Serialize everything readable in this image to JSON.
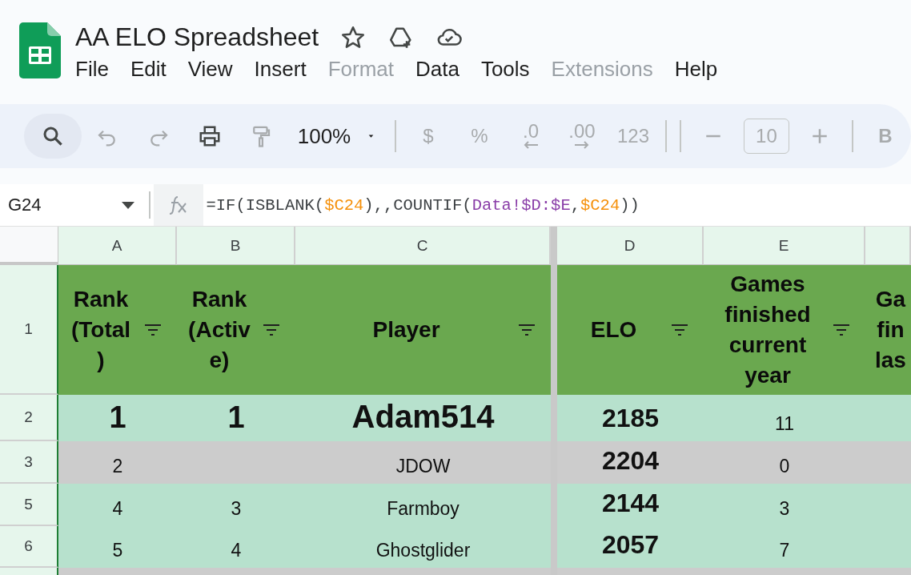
{
  "document": {
    "title": "AA ELO Spreadsheet"
  },
  "menu": [
    {
      "label": "File",
      "disabled": false
    },
    {
      "label": "Edit",
      "disabled": false
    },
    {
      "label": "View",
      "disabled": false
    },
    {
      "label": "Insert",
      "disabled": false
    },
    {
      "label": "Format",
      "disabled": true
    },
    {
      "label": "Data",
      "disabled": false
    },
    {
      "label": "Tools",
      "disabled": false
    },
    {
      "label": "Extensions",
      "disabled": true
    },
    {
      "label": "Help",
      "disabled": false
    }
  ],
  "toolbar": [
    {
      "kind": "search",
      "disabled": false
    },
    {
      "kind": "undo",
      "disabled": true
    },
    {
      "kind": "redo",
      "disabled": true
    },
    {
      "kind": "print",
      "disabled": false
    },
    {
      "kind": "paint",
      "disabled": true
    },
    {
      "kind": "zoom",
      "text": "100%"
    },
    {
      "kind": "sep"
    },
    {
      "kind": "text",
      "text": "$",
      "disabled": true
    },
    {
      "kind": "text",
      "text": "%",
      "disabled": true
    },
    {
      "kind": "decrease",
      "text": ".0",
      "disabled": true
    },
    {
      "kind": "increase",
      "text": ".00",
      "disabled": true
    },
    {
      "kind": "text",
      "text": "123",
      "disabled": true
    },
    {
      "kind": "sep"
    },
    {
      "kind": "sep"
    },
    {
      "kind": "minus",
      "disabled": true
    },
    {
      "kind": "size",
      "text": "10",
      "disabled": true
    },
    {
      "kind": "plus",
      "disabled": true
    },
    {
      "kind": "sep"
    },
    {
      "kind": "text",
      "text": "B",
      "disabled": true,
      "bold": true
    }
  ],
  "name_box": "G24",
  "formula": [
    {
      "text": "=IF(ISBLANK(",
      "color": "#3c4043"
    },
    {
      "text": "$C24",
      "color": "#f5900a"
    },
    {
      "text": "),,COUNTIF(",
      "color": "#3c4043"
    },
    {
      "text": "Data!$D:$E",
      "color": "#8a3ea8"
    },
    {
      "text": ",",
      "color": "#3c4043"
    },
    {
      "text": "$C24",
      "color": "#f5900a"
    },
    {
      "text": "))",
      "color": "#3c4043"
    }
  ],
  "columns": [
    "A",
    "B",
    "C",
    "D",
    "E"
  ],
  "header_row": {
    "number": "1",
    "cells": [
      {
        "text": "Rank\n(Total\n)",
        "filter": true
      },
      {
        "text": "Rank\n(Activ\ne)",
        "filter": true
      },
      {
        "text": "Player",
        "filter": true
      },
      {
        "text": "ELO",
        "filter": true
      },
      {
        "text": "Games\nfinished\ncurrent\nyear",
        "filter": true
      },
      {
        "text": "Ga\nfin\nlas",
        "filter": false
      }
    ]
  },
  "rows": [
    {
      "number": "2",
      "inactive": false,
      "top": true,
      "cells": [
        "1",
        "1",
        "Adam514",
        "2185",
        "11"
      ]
    },
    {
      "number": "3",
      "inactive": true,
      "top": false,
      "cells": [
        "2",
        "",
        "JDOW",
        "2204",
        "0"
      ]
    },
    {
      "number": "5",
      "inactive": false,
      "top": false,
      "cells": [
        "4",
        "3",
        "Farmboy",
        "2144",
        "3"
      ]
    },
    {
      "number": "6",
      "inactive": false,
      "top": false,
      "cells": [
        "5",
        "4",
        "Ghostglider",
        "2057",
        "7"
      ]
    }
  ]
}
